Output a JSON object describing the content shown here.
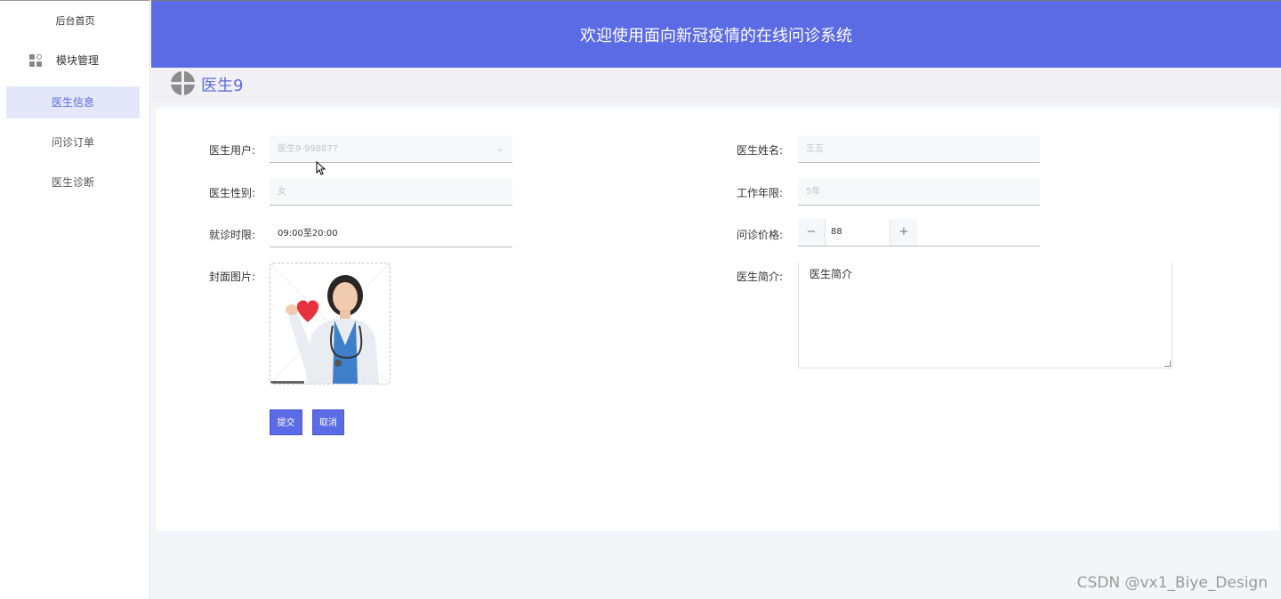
{
  "sidebar": {
    "home": "后台首页",
    "module": "模块管理",
    "items": [
      {
        "label": "医生信息",
        "active": true
      },
      {
        "label": "问诊订单",
        "active": false
      },
      {
        "label": "医生诊断",
        "active": false
      }
    ]
  },
  "header": {
    "title": "欢迎使用面向新冠疫情的在线问诊系统"
  },
  "breadcrumb": {
    "title": "医生9"
  },
  "form": {
    "doctor_user": {
      "label": "医生用户:",
      "value": "医生9-998877"
    },
    "doctor_name": {
      "label": "医生姓名:",
      "value": "王五"
    },
    "doctor_gender": {
      "label": "医生性别:",
      "value": "女"
    },
    "work_years": {
      "label": "工作年限:",
      "value": "5年"
    },
    "visit_hours": {
      "label": "就诊时限:",
      "value": "09:00至20:00"
    },
    "consult_price": {
      "label": "问诊价格:",
      "value": "88",
      "minus": "−",
      "plus": "+"
    },
    "cover_image": {
      "label": "封面图片:"
    },
    "doctor_intro": {
      "label": "医生简介:",
      "value": "医生简介"
    },
    "submit": "提交",
    "cancel": "取消"
  },
  "watermark": "CSDN @vx1_Biye_Design",
  "colors": {
    "accent": "#5b6be5",
    "sidebar_active_bg": "#e4e7f9"
  }
}
